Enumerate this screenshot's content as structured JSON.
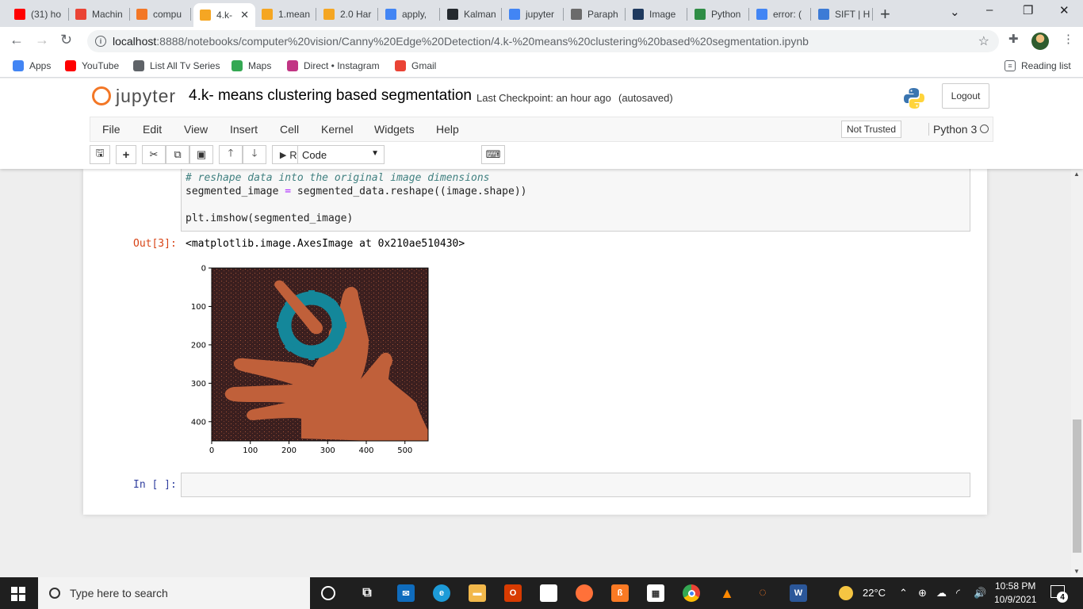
{
  "browser": {
    "tabs": [
      {
        "label": "(31) ho",
        "icon": "youtube-icon",
        "color": "#ff0000"
      },
      {
        "label": "Machin",
        "icon": "gmail-icon",
        "color": "#ea4335"
      },
      {
        "label": "compu",
        "icon": "jupyter-icon",
        "color": "#f37726"
      },
      {
        "label": "4.k-",
        "icon": "notebook-icon",
        "color": "#f5a623",
        "active": true
      },
      {
        "label": "1.mean",
        "icon": "notebook-icon",
        "color": "#f5a623"
      },
      {
        "label": "2.0 Har",
        "icon": "notebook-icon",
        "color": "#f5a623"
      },
      {
        "label": "apply, ",
        "icon": "google-icon",
        "color": "#4285f4"
      },
      {
        "label": "Kalman",
        "icon": "github-icon",
        "color": "#24292e"
      },
      {
        "label": "jupyter",
        "icon": "google-icon",
        "color": "#4285f4"
      },
      {
        "label": "Paraph",
        "icon": "quill-icon",
        "color": "#6b6b6b"
      },
      {
        "label": "Image",
        "icon": "tds-icon",
        "color": "#1f3a5f"
      },
      {
        "label": "Python",
        "icon": "geeks-icon",
        "color": "#2f8d46"
      },
      {
        "label": "error: (",
        "icon": "google-icon",
        "color": "#4285f4"
      },
      {
        "label": "SIFT | H",
        "icon": "chart-icon",
        "color": "#3c7bd6"
      }
    ],
    "url_host": "localhost",
    "url_path": ":8888/notebooks/computer%20vision/Canny%20Edge%20Detection/4.k-%20means%20clustering%20based%20segmentation.ipynb",
    "bookmarks": [
      {
        "label": "Apps",
        "icon": "apps-grid-icon",
        "color": "#4285f4"
      },
      {
        "label": "YouTube",
        "icon": "youtube-icon",
        "color": "#ff0000"
      },
      {
        "label": "List All Tv Series",
        "icon": "tv-icon",
        "color": "#5f6368"
      },
      {
        "label": "Maps",
        "icon": "maps-icon",
        "color": "#34a853"
      },
      {
        "label": "Direct • Instagram",
        "icon": "instagram-icon",
        "color": "#c13584"
      },
      {
        "label": "Gmail",
        "icon": "gmail-icon",
        "color": "#ea4335"
      }
    ],
    "reading_list": "Reading list"
  },
  "jupyter": {
    "logo_text": "jupyter",
    "notebook_title": "4.k- means clustering based segmentation",
    "checkpoint": "Last Checkpoint: an hour ago",
    "autosave": "(autosaved)",
    "logout": "Logout",
    "menu": [
      "File",
      "Edit",
      "View",
      "Insert",
      "Cell",
      "Kernel",
      "Widgets",
      "Help"
    ],
    "trust": "Not Trusted",
    "kernel": "Python 3",
    "run_label": "Run",
    "cell_type": "Code"
  },
  "cells": {
    "code_comment": "# reshape data into the original image dimensions",
    "code_line2_a": "segmented_image ",
    "code_line2_op": "=",
    "code_line2_b": " segmented_data.reshape((image.shape))",
    "code_line3": "plt.imshow(segmented_image)",
    "out_prompt": "Out[3]:",
    "out_text": "<matplotlib.image.AxesImage at 0x210ae510430>",
    "in_prompt": "In [ ]:"
  },
  "chart_data": {
    "type": "image",
    "xticks": [
      "0",
      "100",
      "200",
      "300",
      "400",
      "500"
    ],
    "yticks": [
      "0",
      "100",
      "200",
      "300",
      "400"
    ],
    "xlim": [
      0,
      560
    ],
    "ylim": [
      450,
      0
    ],
    "colors": {
      "background": "#3b1f1f",
      "hand": "#c0603a",
      "gear": "#14879a"
    }
  },
  "taskbar": {
    "search_placeholder": "Type here to search",
    "weather": "22°C",
    "time": "10:58 PM",
    "date": "10/9/2021",
    "notifications": "4"
  }
}
